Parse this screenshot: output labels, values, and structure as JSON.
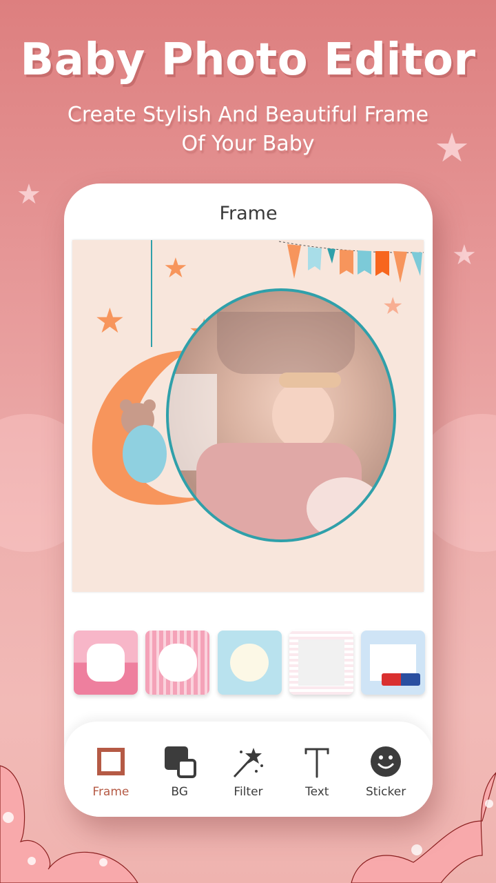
{
  "promo": {
    "title": "Baby Photo Editor",
    "subtitle_line1": "Create Stylish And Beautiful Frame",
    "subtitle_line2": "Of Your Baby"
  },
  "screen": {
    "title": "Frame",
    "canvas": {
      "description": "baby photo inside circular frame with orange moon, teddy bear, stars and bunting"
    },
    "frame_thumbnails": [
      {
        "name": "pink-label-frame",
        "colors": [
          "#f7b6c8",
          "#ee7f9e"
        ]
      },
      {
        "name": "pink-stripes-butterfly-frame",
        "colors": [
          "#f4a2b8",
          "#ffffff"
        ]
      },
      {
        "name": "blue-stars-toys-frame",
        "colors": [
          "#b9e2ee",
          "#fcf8e6"
        ]
      },
      {
        "name": "white-roses-frame",
        "colors": [
          "#fbe9ee",
          "#f1f1f1"
        ]
      },
      {
        "name": "blue-train-bunting-frame",
        "colors": [
          "#cfe4f6",
          "#ffffff"
        ]
      }
    ],
    "toolbar": {
      "active": "Frame",
      "active_color": "#b55a45",
      "items": [
        {
          "label": "Frame",
          "icon": "frame-icon"
        },
        {
          "label": "BG",
          "icon": "bg-layers-icon"
        },
        {
          "label": "Filter",
          "icon": "magic-wand-icon"
        },
        {
          "label": "Text",
          "icon": "text-icon"
        },
        {
          "label": "Sticker",
          "icon": "smiley-icon"
        }
      ]
    }
  }
}
